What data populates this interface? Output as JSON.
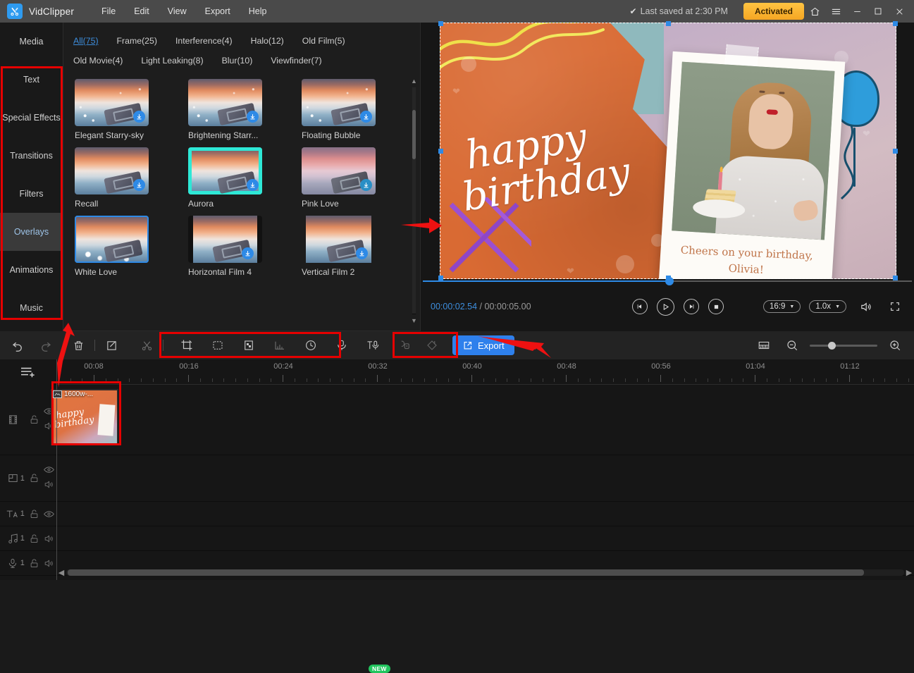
{
  "app": {
    "name": "VidClipper",
    "menus": [
      "File",
      "Edit",
      "View",
      "Export",
      "Help"
    ],
    "saved_status": "Last saved at 2:30 PM",
    "license_label": "Activated",
    "window_buttons": [
      "home-icon",
      "menu-icon",
      "minimize-icon",
      "maximize-icon",
      "close-icon"
    ]
  },
  "sidebar": {
    "items": [
      {
        "label": "Media",
        "active": false
      },
      {
        "label": "Text",
        "active": false
      },
      {
        "label": "Special Effects",
        "active": false
      },
      {
        "label": "Transitions",
        "active": false
      },
      {
        "label": "Filters",
        "active": false
      },
      {
        "label": "Overlays",
        "active": true
      },
      {
        "label": "Animations",
        "active": false
      },
      {
        "label": "Music",
        "active": false
      }
    ]
  },
  "effects_panel": {
    "category_tabs_row1": [
      {
        "label": "All(75)",
        "selected": true
      },
      {
        "label": "Frame(25)",
        "selected": false
      },
      {
        "label": "Interference(4)",
        "selected": false
      },
      {
        "label": "Halo(12)",
        "selected": false
      },
      {
        "label": "Old Film(5)",
        "selected": false
      }
    ],
    "category_tabs_row2": [
      {
        "label": "Old Movie(4)",
        "selected": false
      },
      {
        "label": "Light Leaking(8)",
        "selected": false
      },
      {
        "label": "Blur(10)",
        "selected": false
      },
      {
        "label": "Viewfinder(7)",
        "selected": false
      }
    ],
    "items": [
      {
        "label": "Elegant Starry-sky",
        "download": true,
        "style": "sparkle",
        "selected": false
      },
      {
        "label": "Brightening Starr...",
        "download": true,
        "style": "sparkle",
        "selected": false
      },
      {
        "label": "Floating Bubble",
        "download": true,
        "style": "sparkle",
        "selected": false
      },
      {
        "label": "Recall",
        "download": true,
        "style": "plain",
        "selected": false
      },
      {
        "label": "Aurora",
        "download": true,
        "style": "aurora",
        "selected": false
      },
      {
        "label": "Pink Love",
        "download": true,
        "style": "pink",
        "selected": false
      },
      {
        "label": "White Love",
        "download": false,
        "style": "white",
        "selected": true
      },
      {
        "label": "Horizontal Film 4",
        "download": true,
        "style": "hfilm",
        "selected": false
      },
      {
        "label": "Vertical Film 2",
        "download": true,
        "style": "vfilm",
        "selected": false
      }
    ]
  },
  "preview": {
    "overlay_text_line1": "happy",
    "overlay_text_line2": "birthday",
    "photo_caption_line1": "Cheers on your birthday,",
    "photo_caption_line2": "Olivia!",
    "current_time": "00:00:02.54",
    "separator": "/",
    "total_time": "00:00:05.00",
    "aspect_ratio": "16:9",
    "playback_speed": "1.0x",
    "controls": [
      "step-back-icon",
      "play-icon",
      "step-forward-icon",
      "stop-icon"
    ],
    "right_controls": [
      "volume-icon",
      "fullscreen-icon"
    ]
  },
  "toolbar": {
    "left_icons": [
      "undo-icon",
      "redo-icon",
      "delete-icon",
      "edit-icon",
      "split-icon"
    ],
    "group_icons": [
      "crop-icon",
      "mosaic-icon",
      "chroma-key-icon",
      "audio-levels-icon",
      "speed-clock-icon",
      "voice-record-icon",
      "text-to-speech-icon"
    ],
    "extra_icons": [
      "freeze-frame-icon",
      "shape-mask-icon"
    ],
    "new_badge": "NEW",
    "export_label": "Export",
    "right_icons": [
      "fit-timeline-icon",
      "zoom-out-icon",
      "zoom-in-icon"
    ]
  },
  "timeline": {
    "add_track_icon": "add-track-icon",
    "ruler_labels": [
      "00:08",
      "00:16",
      "00:24",
      "00:32",
      "00:40",
      "00:48",
      "00:56",
      "01:04",
      "01:12"
    ],
    "tracks": [
      {
        "icon": "film-track-icon",
        "count": "",
        "lock": "unlocked-icon",
        "eye": "eye-icon",
        "audio": "speaker-icon"
      },
      {
        "icon": "pip-track-icon",
        "count": "1",
        "lock": "unlocked-icon",
        "eye": "eye-icon",
        "audio": "speaker-icon"
      },
      {
        "icon": "text-track-icon",
        "count": "1",
        "lock": "unlocked-icon",
        "eye": "eye-icon",
        "audio": ""
      },
      {
        "icon": "music-track-icon",
        "count": "1",
        "lock": "unlocked-icon",
        "eye": "",
        "audio": "speaker-icon"
      },
      {
        "icon": "voice-track-icon",
        "count": "1",
        "lock": "unlocked-icon",
        "eye": "",
        "audio": "speaker-icon"
      }
    ],
    "clip": {
      "badge_label": "1600w-...",
      "text_line1": "happy",
      "text_line2": "birthday"
    }
  },
  "colors": {
    "accent_blue": "#2e8ae6",
    "export_blue": "#2e80ec",
    "activated_orange": "#f5a623",
    "annotation_red": "#e60000",
    "new_green": "#22c55e"
  }
}
